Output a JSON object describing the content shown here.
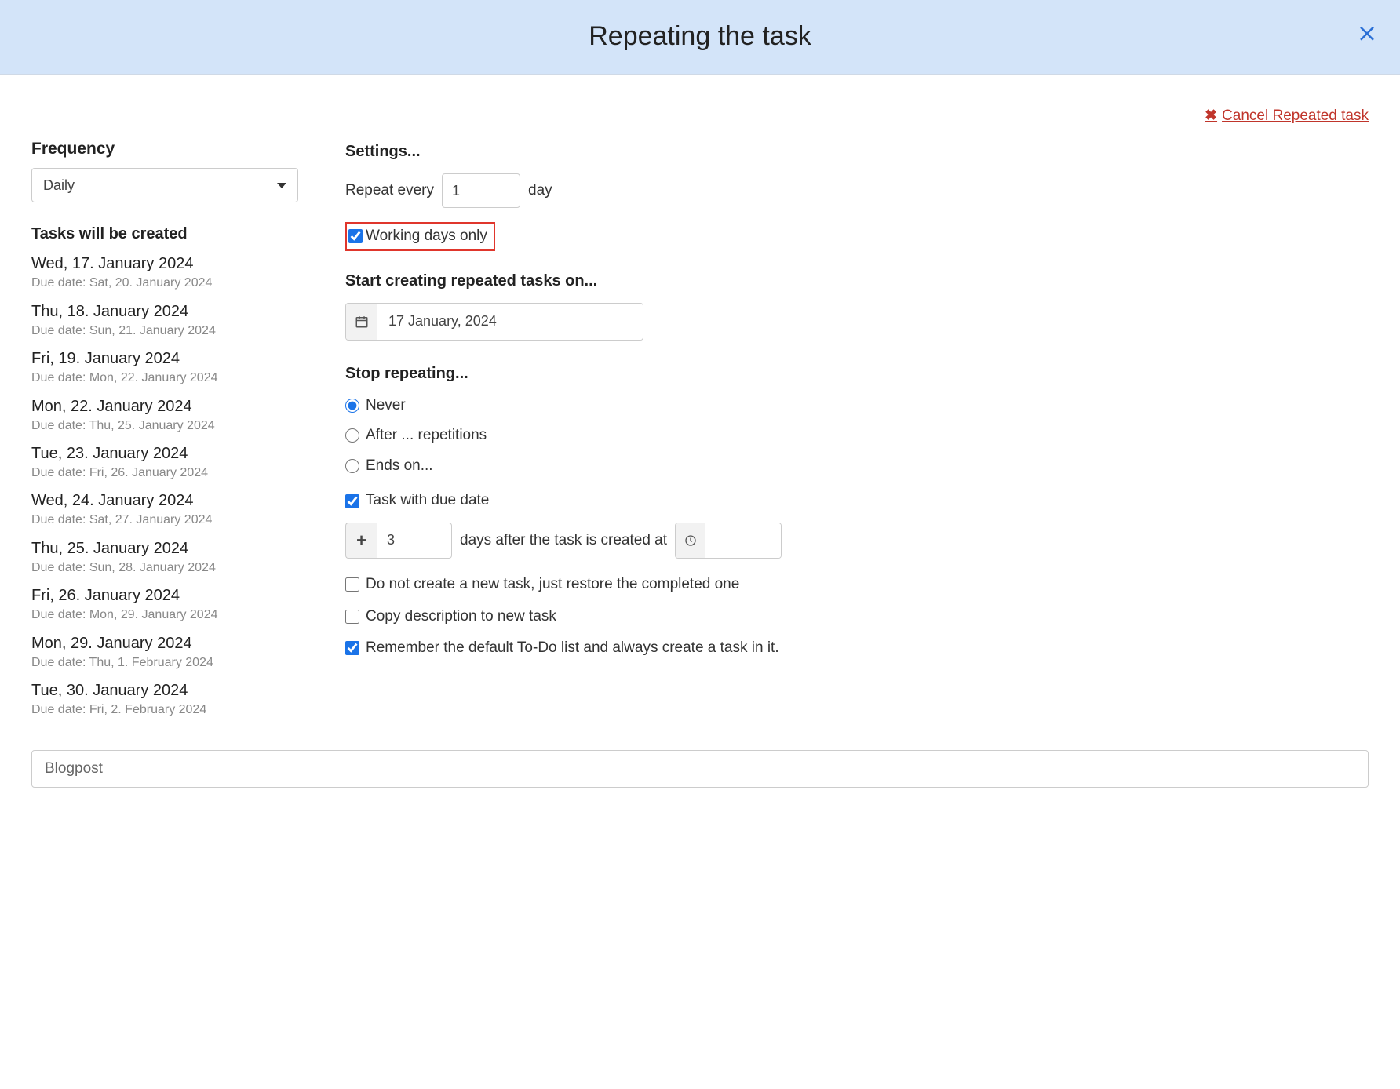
{
  "dialog": {
    "title": "Repeating the task"
  },
  "cancel": {
    "label": "Cancel Repeated task"
  },
  "frequency": {
    "heading": "Frequency",
    "selected": "Daily"
  },
  "preview": {
    "heading": "Tasks will be created",
    "items": [
      {
        "date": "Wed, 17. January 2024",
        "due": "Due date: Sat, 20. January 2024"
      },
      {
        "date": "Thu, 18. January 2024",
        "due": "Due date: Sun, 21. January 2024"
      },
      {
        "date": "Fri, 19. January 2024",
        "due": "Due date: Mon, 22. January 2024"
      },
      {
        "date": "Mon, 22. January 2024",
        "due": "Due date: Thu, 25. January 2024"
      },
      {
        "date": "Tue, 23. January 2024",
        "due": "Due date: Fri, 26. January 2024"
      },
      {
        "date": "Wed, 24. January 2024",
        "due": "Due date: Sat, 27. January 2024"
      },
      {
        "date": "Thu, 25. January 2024",
        "due": "Due date: Sun, 28. January 2024"
      },
      {
        "date": "Fri, 26. January 2024",
        "due": "Due date: Mon, 29. January 2024"
      },
      {
        "date": "Mon, 29. January 2024",
        "due": "Due date: Thu, 1. February 2024"
      },
      {
        "date": "Tue, 30. January 2024",
        "due": "Due date: Fri, 2. February 2024"
      }
    ]
  },
  "settings": {
    "heading": "Settings...",
    "repeat_every_label": "Repeat every",
    "repeat_value": "1",
    "repeat_unit": "day",
    "working_days_label": "Working days only",
    "start_heading": "Start creating repeated tasks on...",
    "start_date": "17 January, 2024",
    "stop_heading": "Stop repeating...",
    "stop_never": "Never",
    "stop_after": "After ... repetitions",
    "stop_ends": "Ends on...",
    "due_checkbox_label": "Task with due date",
    "due_days_value": "3",
    "due_days_suffix": "days after the task is created at",
    "restore_label": "Do not create a new task, just restore the completed one",
    "copy_desc_label": "Copy description to new task",
    "remember_list_label": "Remember the default To-Do list and always create a task in it."
  },
  "footer": {
    "task_name": "Blogpost"
  }
}
